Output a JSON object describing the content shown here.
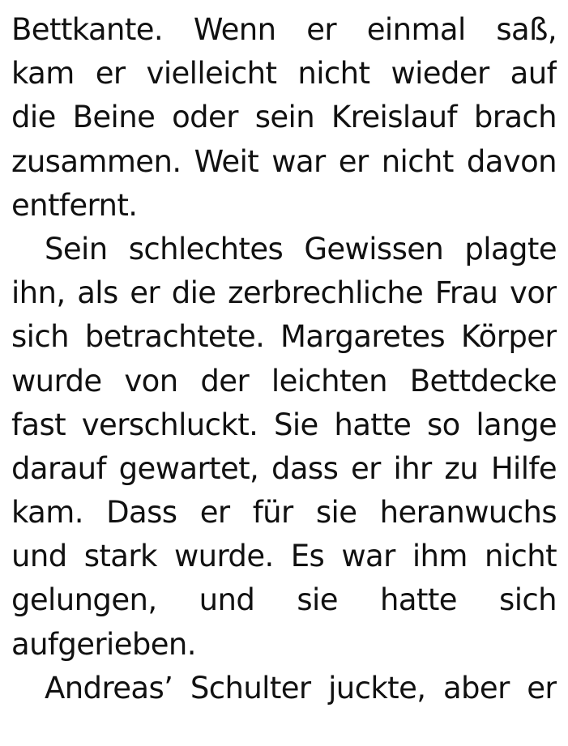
{
  "page": {
    "lines": [
      "Bettkante. Wenn er einmal saß,",
      "kam er vielleicht nicht wieder auf",
      "die Beine oder sein Kreislauf brach",
      "zusammen. Weit war er nicht davon",
      "entfernt.",
      "Sein schlechtes Gewissen plagte",
      "ihn, als er die zerbrechliche Frau vor",
      "sich betrachtete. Margaretes Körper",
      "wurde von der leichten Bettdecke",
      "fast verschluckt. Sie hatte so lange",
      "darauf gewartet, dass er ihr zu Hilfe",
      "kam. Dass er für sie heranwuchs",
      "und stark wurde. Es war ihm nicht",
      "gelungen, und sie hatte sich",
      "aufgerieben.",
      "Andreas’ Schulter juckte, aber er"
    ]
  }
}
